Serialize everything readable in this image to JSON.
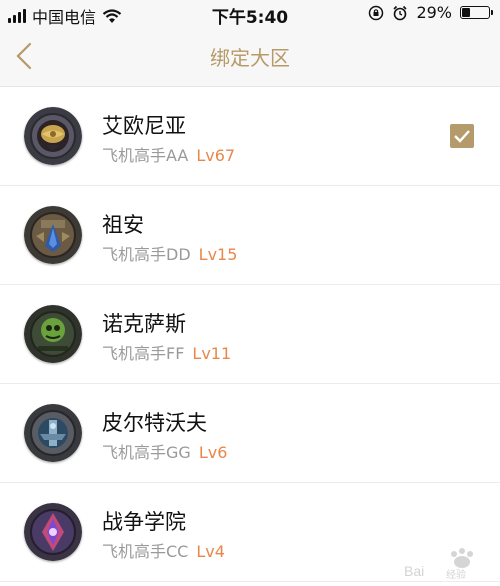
{
  "status_bar": {
    "carrier": "中国电信",
    "time": "下午5:40",
    "battery": "29%",
    "battery_level": 0.29
  },
  "nav": {
    "title": "绑定大区",
    "accent": "#b79a68"
  },
  "regions": [
    {
      "name": "艾欧尼亚",
      "account": "飞机高手AA",
      "level": "Lv67",
      "checked": true,
      "emblem": "ionia-emblem"
    },
    {
      "name": "祖安",
      "account": "飞机高手DD",
      "level": "Lv15",
      "checked": false,
      "emblem": "zaun-emblem"
    },
    {
      "name": "诺克萨斯",
      "account": "飞机高手FF",
      "level": "Lv11",
      "checked": false,
      "emblem": "noxus-emblem"
    },
    {
      "name": "皮尔特沃夫",
      "account": "飞机高手GG",
      "level": "Lv6",
      "checked": false,
      "emblem": "piltover-emblem"
    },
    {
      "name": "战争学院",
      "account": "飞机高手CC",
      "level": "Lv4",
      "checked": false,
      "emblem": "war-academy-emblem"
    }
  ],
  "colors": {
    "level": "#e8874b",
    "checkbox": "#b59b6c"
  }
}
